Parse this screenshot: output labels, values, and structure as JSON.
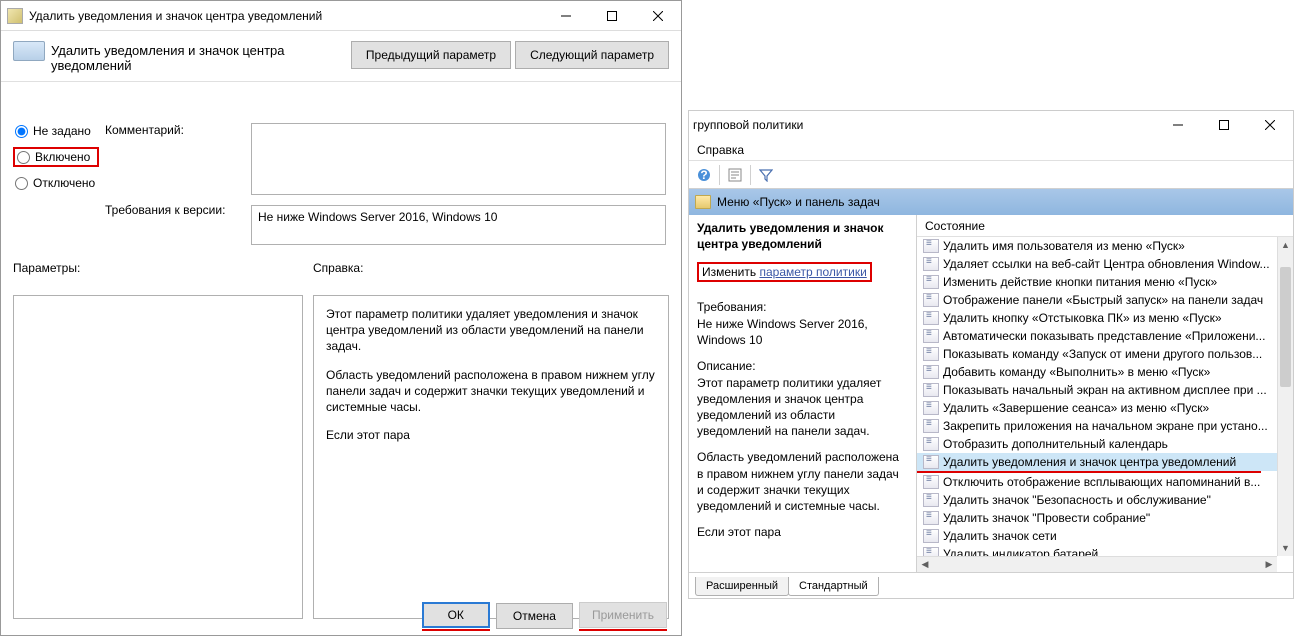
{
  "dialog": {
    "title": "Удалить уведомления и значок центра уведомлений",
    "header": "Удалить уведомления и значок центра уведомлений",
    "prev_btn": "Предыдущий параметр",
    "next_btn": "Следующий параметр",
    "opt_not_configured": "Не задано",
    "opt_enabled": "Включено",
    "opt_disabled": "Отключено",
    "comment_label": "Комментарий:",
    "requirements_label": "Требования к версии:",
    "requirements_value": "Не ниже Windows Server 2016, Windows 10",
    "parameters_label": "Параметры:",
    "help_label": "Справка:",
    "help_p1": "Этот параметр политики удаляет уведомления и значок центра уведомлений из области уведомлений на панели задач.",
    "help_p2": "Область уведомлений расположена в правом нижнем углу панели задач и содержит значки текущих уведомлений и системные часы.",
    "help_p3": "Если этот пара",
    "ok": "ОК",
    "cancel": "Отмена",
    "apply": "Применить"
  },
  "mmc": {
    "title_suffix": "групповой политики",
    "menu_help": "Справка",
    "crumb": "Меню «Пуск» и панель задач",
    "left": {
      "title": "Удалить уведомления и значок центра уведомлений",
      "change_prefix": "Изменить ",
      "change_link": "параметр политики",
      "req_label": "Требования:",
      "req_value": "Не ниже Windows Server 2016, Windows 10",
      "desc_label": "Описание:",
      "desc_p1": "Этот параметр политики удаляет уведомления и значок центра уведомлений из области уведомлений на панели задач.",
      "desc_p2": "Область уведомлений расположена в правом нижнем углу панели задач и содержит значки текущих уведомлений и системные часы.",
      "desc_p3": "Если этот пара"
    },
    "col_state": "Состояние",
    "items": [
      "Удалить имя пользователя из меню «Пуск»",
      "Удаляет ссылки на веб-сайт Центра обновления Window...",
      "Изменить действие кнопки питания меню «Пуск»",
      "Отображение панели «Быстрый запуск» на панели задач",
      "Удалить кнопку «Отстыковка ПК» из меню «Пуск»",
      "Автоматически показывать представление «Приложени...",
      "Показывать команду «Запуск от имени другого пользов...",
      "Добавить команду «Выполнить» в меню «Пуск»",
      "Показывать начальный экран на активном дисплее при ...",
      "Удалить «Завершение сеанса» из меню «Пуск»",
      "Закрепить приложения на начальном экране при устано...",
      "Отобразить дополнительный календарь",
      "Удалить уведомления и значок центра уведомлений",
      "Отключить отображение всплывающих напоминаний в...",
      "Удалить значок \"Безопасность и обслуживание\"",
      "Удалить значок \"Провести собрание\"",
      "Удалить значок сети",
      "Удалить индикатор батарей"
    ],
    "selected_index": 12,
    "tab_ext": "Расширенный",
    "tab_std": "Стандартный"
  }
}
